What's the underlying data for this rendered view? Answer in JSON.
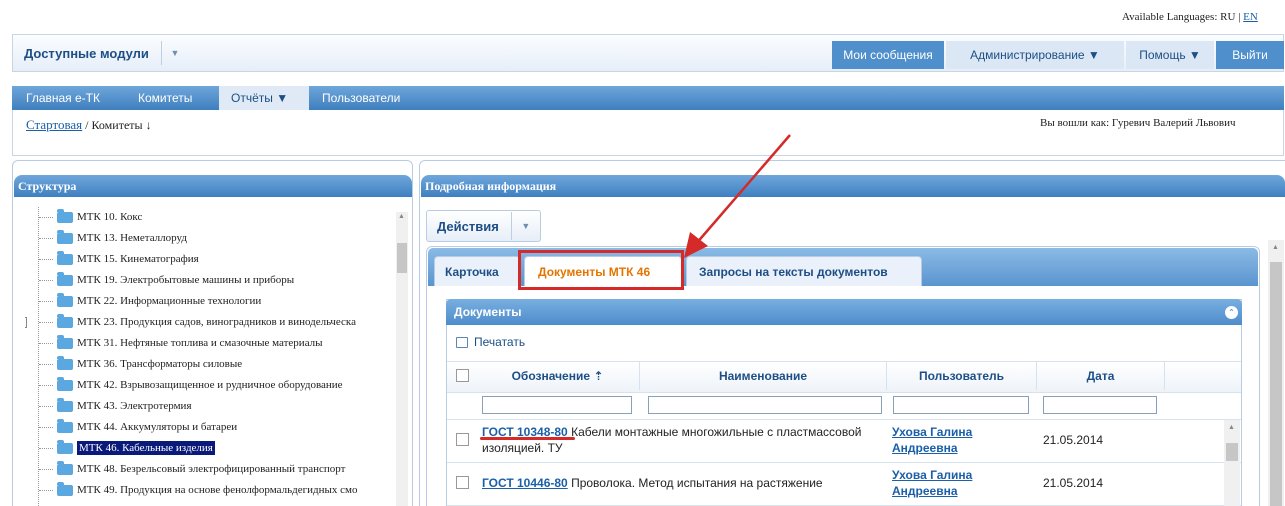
{
  "language_bar": {
    "label": "Available Languages:",
    "ru": "RU",
    "separator": "|",
    "en": "EN"
  },
  "modules": {
    "label": "Доступные модули",
    "dropdown": "▼"
  },
  "top_nav": [
    {
      "label": "Мои сообщения"
    },
    {
      "label": "Администрирование ▼"
    },
    {
      "label": "Помощь ▼"
    },
    {
      "label": "Выйти"
    }
  ],
  "main_nav": [
    {
      "label": "Главная е-ТК"
    },
    {
      "label": "Комитеты"
    },
    {
      "label": "Отчёты ▼"
    },
    {
      "label": "Пользователи"
    }
  ],
  "breadcrumb": {
    "home": "Стартовая",
    "current": "/ Комитеты ↓"
  },
  "user_info": "Вы вошли как: Гуревич Валерий Львович",
  "left_panel": {
    "title": "Структура",
    "tree": [
      {
        "label": "МТК 10. Кокс"
      },
      {
        "label": "МТК 13. Неметаллоруд"
      },
      {
        "label": "МТК 15. Кинематография"
      },
      {
        "label": "МТК 19. Электробытовые машины и приборы"
      },
      {
        "label": "МТК 22. Информационные технологии"
      },
      {
        "label": "МТК 23. Продукция садов, виноградников и винодельческа"
      },
      {
        "label": "МТК 31. Нефтяные топлива и смазочные материалы"
      },
      {
        "label": "МТК 36. Трансформаторы силовые"
      },
      {
        "label": "МТК 42. Взрывозащищенное и рудничное оборудование"
      },
      {
        "label": "МТК 43. Электротермия"
      },
      {
        "label": "МТК 44. Аккумуляторы и батареи"
      },
      {
        "label": "МТК 46. Кабельные изделия"
      },
      {
        "label": "МТК 48. Безрельсовый электрофицированный транспорт"
      },
      {
        "label": "МТК 49. Продукция на основе фенолформальдегидных смо"
      }
    ],
    "expander": "+"
  },
  "right_panel": {
    "title": "Подробная информация",
    "actions": {
      "label": "Действия",
      "dropdown": "▼"
    },
    "tabs": [
      {
        "label": "Карточка"
      },
      {
        "label": "Документы МТК 46"
      },
      {
        "label": "Запросы на тексты документов"
      }
    ],
    "documents": {
      "title": "Документы",
      "collapse": "⌃",
      "print": "Печатать",
      "columns": [
        "Обозначение ⇡",
        "Наименование",
        "Пользователь",
        "Дата"
      ],
      "rows": [
        {
          "code": "ГОСТ 10348-80",
          "name": "Кабели монтажные многожильные с пластмассовой изоляцией. ТУ",
          "user": "Ухова Галина Андреевна",
          "date": "21.05.2014"
        },
        {
          "code": "ГОСТ 10446-80",
          "name": "Проволока. Метод испытания на растяжение",
          "user": "Ухова Галина Андреевна",
          "date": "21.05.2014"
        }
      ]
    }
  },
  "colors": {
    "accent": "#4f8fcb",
    "highlight": "#d42a2a",
    "active_tab": "#e57400",
    "selection": "#0a1a7a"
  }
}
